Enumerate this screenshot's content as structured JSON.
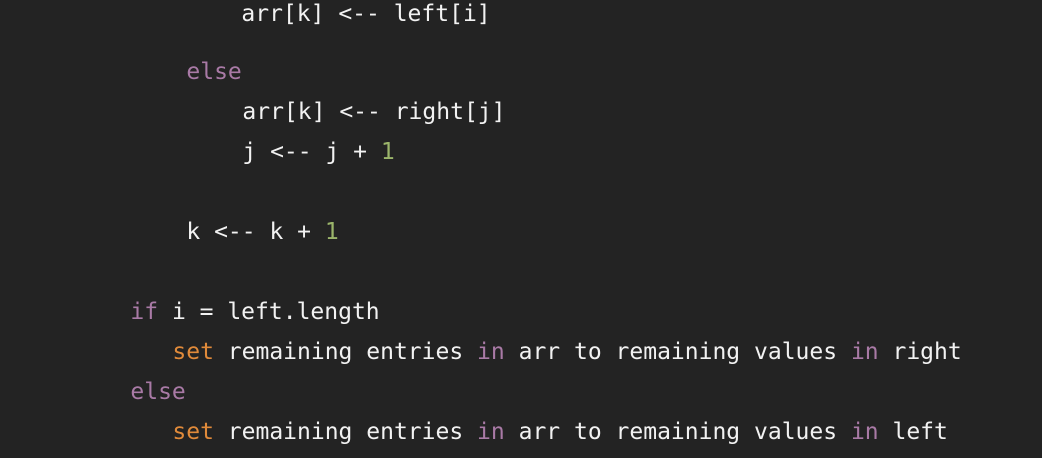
{
  "colors": {
    "background": "#232323",
    "text": "#f2f2f2",
    "keyword": "#a97aa6",
    "function": "#e08a3a",
    "number": "#9bb56a"
  },
  "code": {
    "partial_top": "arr[k] <-- left[i]",
    "lines": [
      {
        "tokens": [
          {
            "text": "else",
            "kind": "kw"
          }
        ]
      },
      {
        "tokens": [
          {
            "text": "arr[k] <-- right[j]",
            "kind": "txt"
          }
        ]
      },
      {
        "tokens": [
          {
            "text": "j <-- j + ",
            "kind": "txt"
          },
          {
            "text": "1",
            "kind": "num"
          }
        ]
      },
      {
        "tokens": [
          {
            "text": "k <-- k + ",
            "kind": "txt"
          },
          {
            "text": "1",
            "kind": "num"
          }
        ]
      },
      {
        "tokens": [
          {
            "text": "if",
            "kind": "kw"
          },
          {
            "text": " i = left.length",
            "kind": "txt"
          }
        ]
      },
      {
        "tokens": [
          {
            "text": "set",
            "kind": "fn"
          },
          {
            "text": " remaining entries ",
            "kind": "txt"
          },
          {
            "text": "in",
            "kind": "kw"
          },
          {
            "text": " arr to remaining values ",
            "kind": "txt"
          },
          {
            "text": "in",
            "kind": "kw"
          },
          {
            "text": " right",
            "kind": "txt"
          }
        ]
      },
      {
        "tokens": [
          {
            "text": "else",
            "kind": "kw"
          }
        ]
      },
      {
        "tokens": [
          {
            "text": "set",
            "kind": "fn"
          },
          {
            "text": " remaining entries ",
            "kind": "txt"
          },
          {
            "text": "in",
            "kind": "kw"
          },
          {
            "text": " arr to remaining values ",
            "kind": "txt"
          },
          {
            "text": "in",
            "kind": "kw"
          },
          {
            "text": " left",
            "kind": "txt"
          }
        ]
      }
    ]
  }
}
